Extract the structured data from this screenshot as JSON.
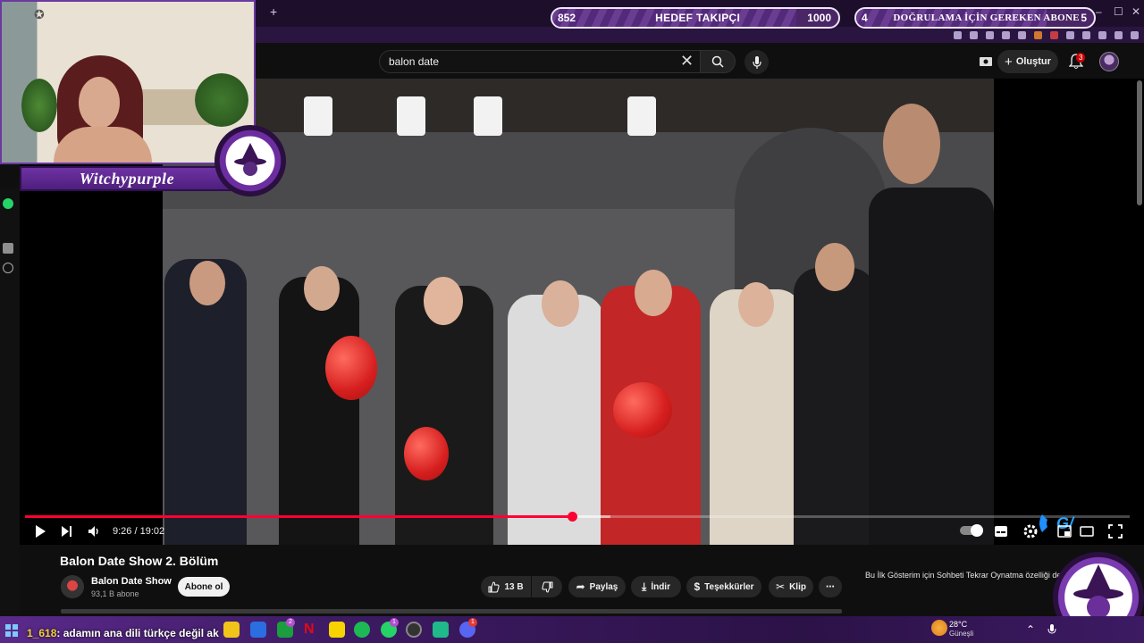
{
  "stream_overlay": {
    "follower_goal": {
      "current": "852",
      "title": "HEDEF TAKIPÇI",
      "target": "1000",
      "progress": 0.852
    },
    "sub_goal": {
      "current": "4",
      "title": "DOĞRULAMA İÇİN GEREKEN ABONE",
      "target": "5",
      "progress": 0.8
    },
    "streamer_name": "Witchypurple"
  },
  "browser": {
    "new_tab_label": "+",
    "window_controls": [
      "–",
      "☐",
      "✕"
    ]
  },
  "youtube": {
    "search": {
      "value": "balon date",
      "clear_label": "✕"
    },
    "create_label": "Oluştur",
    "notification_count": "3",
    "player": {
      "time": "9:26 / 19:02",
      "progress": 0.495,
      "buffered": 0.53
    },
    "video": {
      "title": "Balon Date Show 2. Bölüm",
      "channel": "Balon Date Show",
      "subscribers": "93,1 B abone",
      "subscribe_label": "Abone ol",
      "likes": "13 B",
      "share_label": "Paylaş",
      "download_label": "İndir",
      "thanks_label": "Teşekkürler",
      "clip_label": "Klip",
      "more_label": "⋯"
    },
    "side_message": "Bu İlk Gösterim için Sohbeti Tekrar Oynatma özelliği de dışı."
  },
  "taskbar": {
    "chat_user": "1_618",
    "chat_message": ": adamın ana dili türkçe değil ak",
    "weather_temp": "28°C",
    "weather_desc": "Güneşli",
    "badges": {
      "xbox": "2",
      "messenger": "1",
      "discord": "1"
    }
  },
  "colors": {
    "accent_purple": "#6b3aa0",
    "progress_red": "#ff0033",
    "background": "#0f0f0f"
  }
}
